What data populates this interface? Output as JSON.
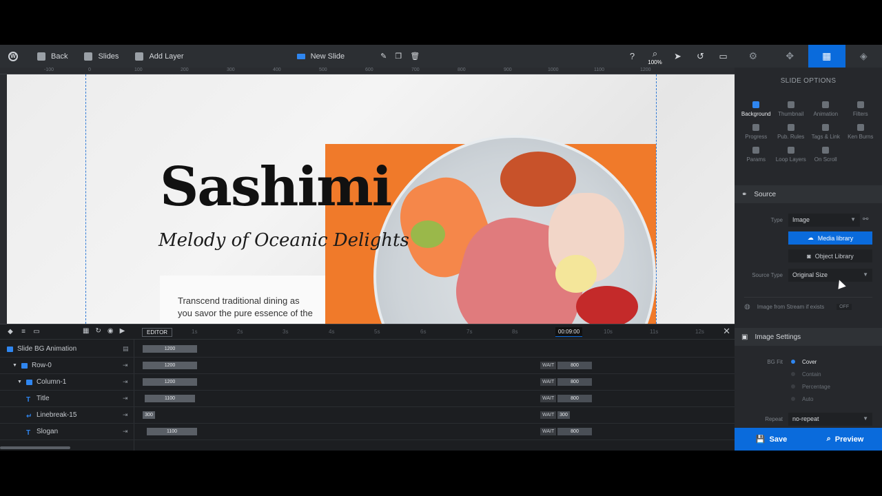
{
  "toolbar": {
    "back": "Back",
    "slides": "Slides",
    "add_layer": "Add Layer",
    "slide_name": "New Slide",
    "zoom": "100%"
  },
  "ruler": [
    "-100",
    "0",
    "100",
    "200",
    "300",
    "400",
    "500",
    "600",
    "700",
    "800",
    "900",
    "1000",
    "1100",
    "1200"
  ],
  "canvas": {
    "title": "Sashimi",
    "slogan": "Melody of Oceanic Delights",
    "body": "Transcend traditional dining as you savor the pure essence of the"
  },
  "sidebar": {
    "section_title": "SLIDE OPTIONS",
    "options": [
      {
        "label": "Background",
        "icon": "image-icon"
      },
      {
        "label": "Thumbnail",
        "icon": "thumbnail-icon"
      },
      {
        "label": "Animation",
        "icon": "film-icon"
      },
      {
        "label": "Filters",
        "icon": "filters-icon"
      },
      {
        "label": "Progress",
        "icon": "progress-icon"
      },
      {
        "label": "Pub. Rules",
        "icon": "clock-icon"
      },
      {
        "label": "Tags & Link",
        "icon": "code-icon"
      },
      {
        "label": "Ken Burns",
        "icon": "kenburns-icon"
      },
      {
        "label": "Params",
        "icon": "info-icon"
      },
      {
        "label": "Loop Layers",
        "icon": "loop-icon"
      },
      {
        "label": "On Scroll",
        "icon": "scroll-icon"
      }
    ],
    "source": {
      "heading": "Source",
      "type_label": "Type",
      "type_value": "Image",
      "media_library": "Media library",
      "object_library": "Object Library",
      "source_type_label": "Source Type",
      "source_type_value": "Original Size",
      "stream_label": "Image from Stream if exists",
      "stream_toggle": "OFF"
    },
    "image_settings": {
      "heading": "Image Settings",
      "bg_fit_label": "BG Fit",
      "fit_options": [
        "Cover",
        "Contain",
        "Percentage",
        "Auto"
      ],
      "repeat_label": "Repeat",
      "repeat_value": "no-repeat"
    },
    "save": "Save",
    "preview": "Preview"
  },
  "timeline": {
    "editor_tag": "EDITOR",
    "ticks": [
      "1s",
      "2s",
      "3s",
      "4s",
      "5s",
      "6s",
      "7s",
      "8s",
      "10s",
      "11s",
      "12s"
    ],
    "current_time": "00:09:00",
    "layers": [
      {
        "name": "Slide BG Animation",
        "start": "1200",
        "wait": "",
        "end": ""
      },
      {
        "name": "Row-0",
        "start": "1200",
        "wait": "WAIT",
        "end": "800"
      },
      {
        "name": "Column-1",
        "start": "1200",
        "wait": "WAIT",
        "end": "800"
      },
      {
        "name": "Title",
        "start": "1100",
        "wait": "WAIT",
        "end": "800"
      },
      {
        "name": "Linebreak-15",
        "start": "300",
        "wait": "WAIT",
        "end": "300"
      },
      {
        "name": "Slogan",
        "start": "1100",
        "wait": "WAIT",
        "end": "800"
      }
    ]
  }
}
